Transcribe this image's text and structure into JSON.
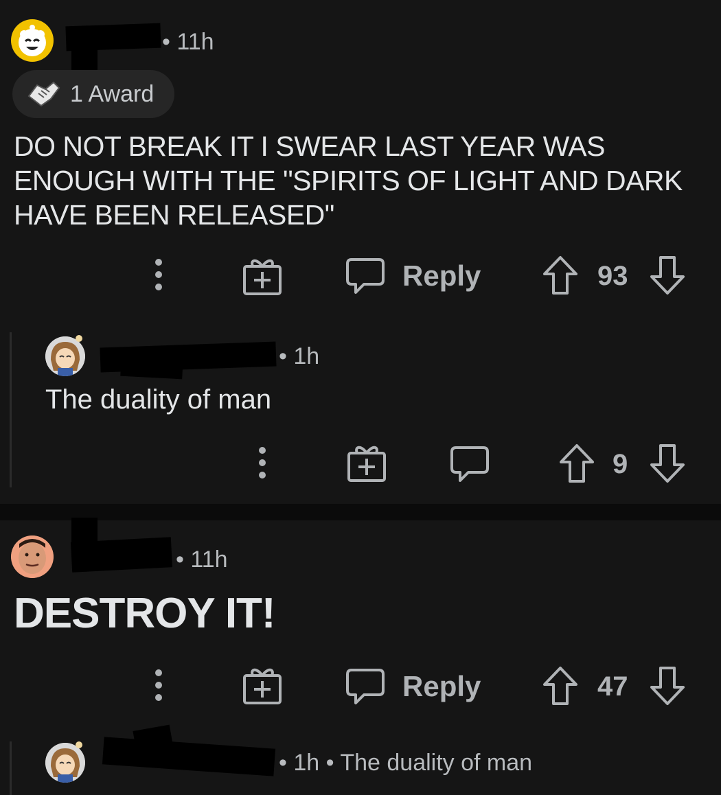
{
  "comments": [
    {
      "time": "• 11h",
      "award_label": "1 Award",
      "text": "DO NOT BREAK IT I SWEAR LAST YEAR WAS ENOUGH WITH THE \"SPIRITS OF LIGHT AND DARK HAVE BEEN RELEASED\"",
      "reply_label": "Reply",
      "score": "93"
    },
    {
      "time": "• 1h",
      "text": "The duality of man",
      "score": "9"
    },
    {
      "time": "• 11h",
      "text": "DESTROY IT!",
      "reply_label": "Reply",
      "score": "47"
    },
    {
      "time": "• 1h • The duality of man"
    }
  ],
  "icons": {
    "more": "vertical-dots-icon",
    "gift": "gift-plus-icon",
    "reply": "speech-bubble-icon",
    "upvote": "up-arrow-icon",
    "downvote": "down-arrow-icon",
    "award": "handshake-award-icon"
  },
  "colors": {
    "background": "#151515",
    "text": "#e4e6e8",
    "muted": "#b0b3b6",
    "separator": "#0b0b0b"
  }
}
